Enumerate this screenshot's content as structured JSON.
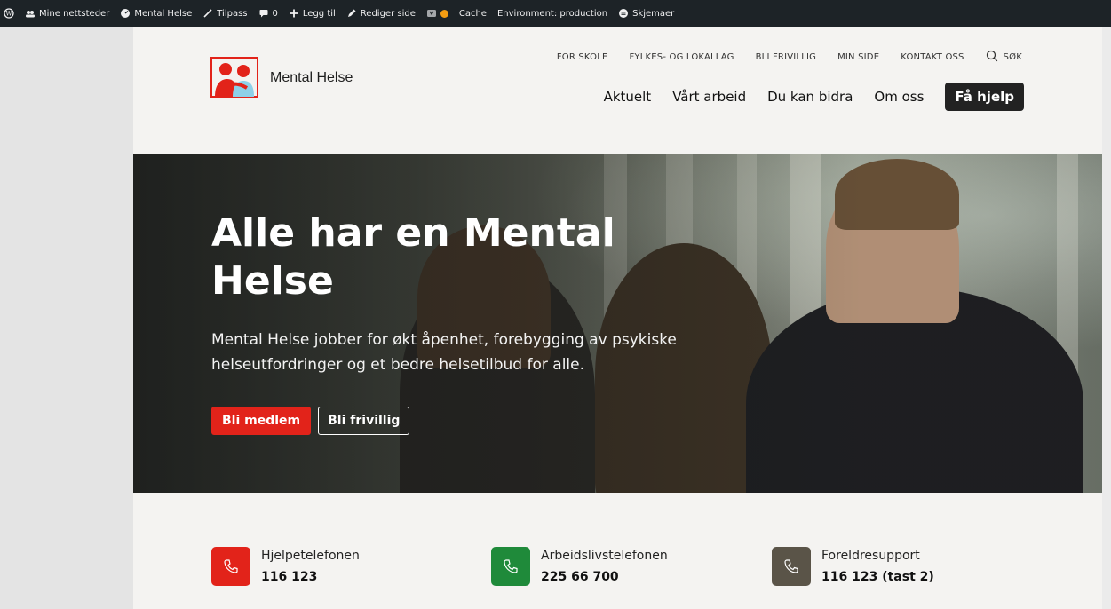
{
  "adminbar": {
    "items": [
      {
        "label": "",
        "icon": "wordpress-icon"
      },
      {
        "label": "Mine nettsteder",
        "icon": "sites-icon"
      },
      {
        "label": "Mental Helse",
        "icon": "dashboard-icon"
      },
      {
        "label": "Tilpass",
        "icon": "brush-icon"
      },
      {
        "label": "0",
        "icon": "comment-icon"
      },
      {
        "label": "Legg til",
        "icon": "plus-icon"
      },
      {
        "label": "Rediger side",
        "icon": "pencil-icon"
      },
      {
        "label": "",
        "icon": "yoast-icon"
      },
      {
        "label": "Cache",
        "icon": "status-dot-icon"
      },
      {
        "label": "Environment: production",
        "icon": ""
      },
      {
        "label": "Skjemaer",
        "icon": "forms-icon"
      }
    ],
    "status_dot_color": "#f39c12"
  },
  "header": {
    "logo_text": "Mental Helse",
    "utility_nav": [
      "FOR SKOLE",
      "FYLKES- OG LOKALLAG",
      "BLI FRIVILLIG",
      "MIN SIDE",
      "KONTAKT OSS"
    ],
    "search_label": "SØK",
    "main_nav": [
      "Aktuelt",
      "Vårt arbeid",
      "Du kan bidra",
      "Om oss"
    ],
    "help_button": "Få hjelp"
  },
  "hero": {
    "title": "Alle har en Mental Helse",
    "subtitle": "Mental Helse jobber for økt åpenhet, forebygging av psykiske helseutfordringer og et bedre helsetilbud for alle.",
    "primary_button": "Bli medlem",
    "secondary_button": "Bli frivillig"
  },
  "contacts": [
    {
      "label": "Hjelpetelefonen",
      "number": "116 123",
      "color": "#e2231a"
    },
    {
      "label": "Arbeidslivstelefonen",
      "number": "225 66 700",
      "color": "#1f8a3a"
    },
    {
      "label": "Foreldresupport",
      "number": "116 123 (tast 2)",
      "color": "#5a5448"
    }
  ],
  "colors": {
    "brand_red": "#e2231a",
    "dark": "#222222",
    "page_bg": "#f4f3f1"
  }
}
